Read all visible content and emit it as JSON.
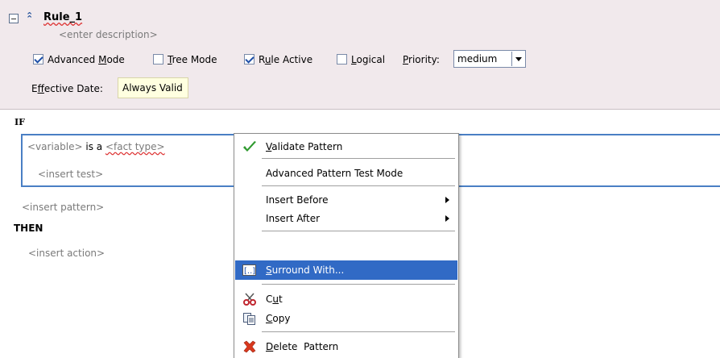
{
  "rule": {
    "name": "Rule_1",
    "description": "<enter description>"
  },
  "options": {
    "advanced_mode": {
      "label_pre": "Advanced ",
      "label_ul": "M",
      "label_post": "ode",
      "checked": true
    },
    "tree_mode": {
      "label_pre": "",
      "label_ul": "T",
      "label_post": "ree Mode",
      "checked": false
    },
    "rule_active": {
      "label_pre": "R",
      "label_ul": "u",
      "label_post": "le Active",
      "checked": true
    },
    "logical": {
      "label_pre": "",
      "label_ul": "L",
      "label_post": "ogical",
      "checked": false
    },
    "priority": {
      "label_pre": "",
      "label_ul": "P",
      "label_post": "riority:",
      "value": "medium"
    }
  },
  "effective_date": {
    "label_pre": "E",
    "label_ul": "f",
    "label_post": "fective Date:",
    "value": "Always Valid"
  },
  "if_section": {
    "heading": "IF",
    "variable": "<variable>",
    "is_a": "is a",
    "fact_type": "<fact type>",
    "insert_test": "<insert test>",
    "insert_pattern": "<insert pattern>"
  },
  "then_section": {
    "heading": "THEN",
    "insert_action": "<insert action>"
  },
  "context_menu": {
    "validate": {
      "ul": "V",
      "rest": "alidate Pattern"
    },
    "advanced_test": {
      "label": "Advanced Pattern Test Mode"
    },
    "insert_before": {
      "label": "Insert Before"
    },
    "insert_after": {
      "label": "Insert After"
    },
    "surround": {
      "ul": "S",
      "rest": "urround With..."
    },
    "cut": {
      "pre": "C",
      "ul": "u",
      "rest": "t"
    },
    "copy": {
      "ul": "C",
      "rest": "opy"
    },
    "delete": {
      "ul": "D",
      "rest": "elete  Pattern"
    }
  },
  "colors": {
    "header_bg": "#f1e9ec",
    "pattern_border": "#4a7fc4",
    "menu_highlight": "#316ac5",
    "date_bg": "#ffffe0"
  },
  "icons": [
    "collapse-icon",
    "move-up-icon",
    "check-icon",
    "surround-icon",
    "scissors-icon",
    "copy-icon",
    "delete-x-icon",
    "submenu-arrow-icon",
    "dropdown-arrow-icon"
  ]
}
